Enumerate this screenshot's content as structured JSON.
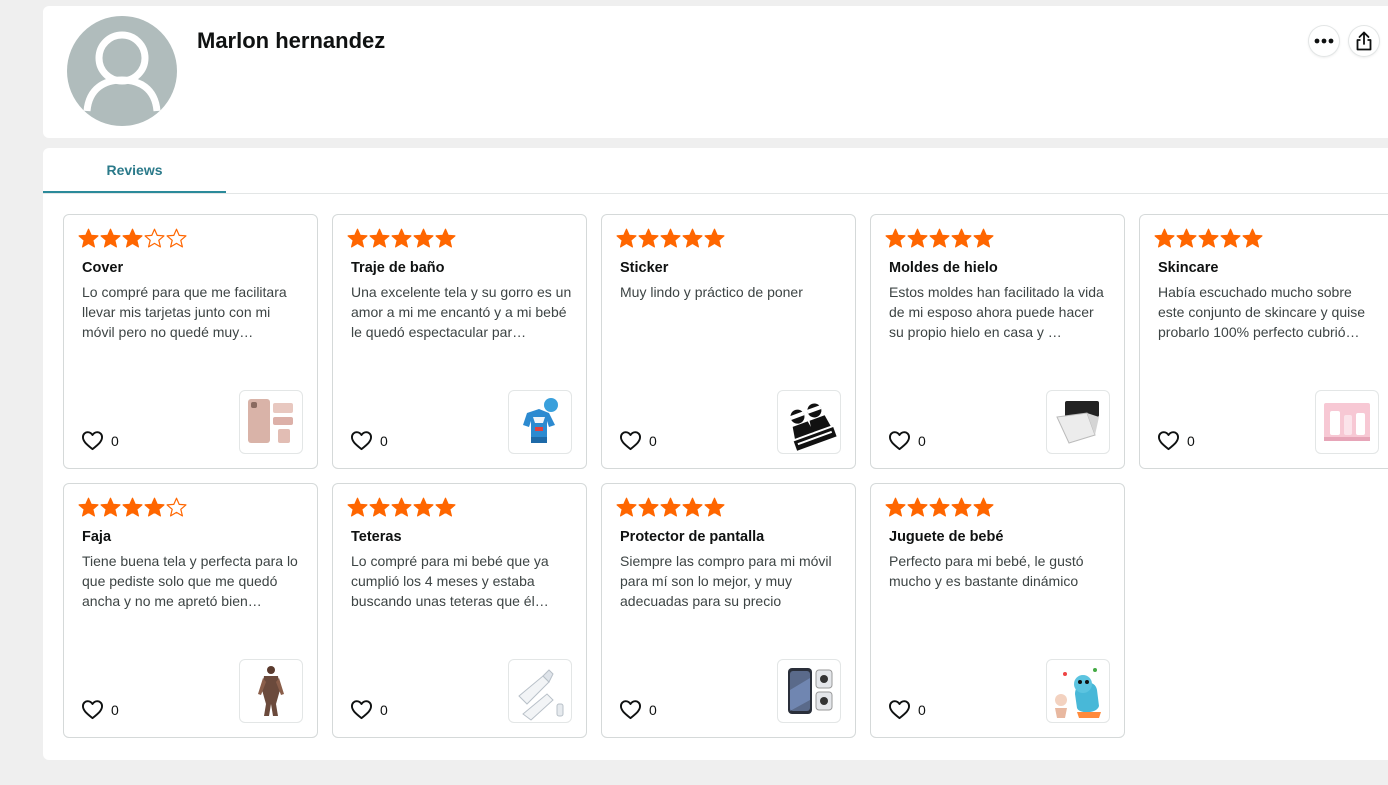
{
  "profile": {
    "name": "Marlon hernandez",
    "avatar_icon": "default-user-avatar-icon",
    "more_icon": "more-options-icon",
    "share_icon": "share-icon"
  },
  "tabs": [
    {
      "label": "Reviews",
      "active": true
    }
  ],
  "colors": {
    "star": "#ff6600",
    "accent": "#2b8a9a",
    "avatar_bg": "#b0bcbc"
  },
  "reviews": [
    {
      "rating": 3,
      "title": "Cover",
      "text": "Lo compré para que me facilitara llevar mis tarjetas junto con mi móvil pero no quedé muy…",
      "likes": "0",
      "thumb": "phone-wallet-case-thumbnail"
    },
    {
      "rating": 5,
      "title": "Traje de baño",
      "text": "Una excelente tela y su gorro es un amor a mi me encantó y a mi bebé le quedó espectacular par…",
      "likes": "0",
      "thumb": "baby-swimsuit-thumbnail"
    },
    {
      "rating": 5,
      "title": "Sticker",
      "text": "Muy lindo y práctico de poner",
      "likes": "0",
      "thumb": "baby-on-board-sticker-thumbnail"
    },
    {
      "rating": 5,
      "title": "Moldes de hielo",
      "text": "Estos moldes han facilitado la vida de mi esposo ahora puede hacer su propio hielo en casa y …",
      "likes": "0",
      "thumb": "ice-mold-thumbnail"
    },
    {
      "rating": 5,
      "title": "Skincare",
      "text": "Había escuchado mucho sobre este conjunto de skincare y quise probarlo 100% perfecto cubrió…",
      "likes": "0",
      "thumb": "skincare-set-thumbnail"
    },
    {
      "rating": 4,
      "title": "Faja",
      "text": "Tiene buena tela y perfecta para lo que pediste solo que me quedó ancha y no me apretó bien…",
      "likes": "0",
      "thumb": "shapewear-thumbnail"
    },
    {
      "rating": 5,
      "title": "Teteras",
      "text": "Lo compré para mi bebé que ya cumplió los 4 meses y estaba buscando unas teteras que él…",
      "likes": "0",
      "thumb": "baby-bottles-thumbnail"
    },
    {
      "rating": 5,
      "title": "Protector de pantalla",
      "text": "Siempre las compro para mi móvil para mí son lo mejor, y muy adecuadas para su precio",
      "likes": "0",
      "thumb": "screen-protector-thumbnail"
    },
    {
      "rating": 5,
      "title": "Juguete de bebé",
      "text": "Perfecto para mi bebé, le gustó mucho y es bastante dinámico",
      "likes": "0",
      "thumb": "baby-toy-thumbnail"
    }
  ]
}
